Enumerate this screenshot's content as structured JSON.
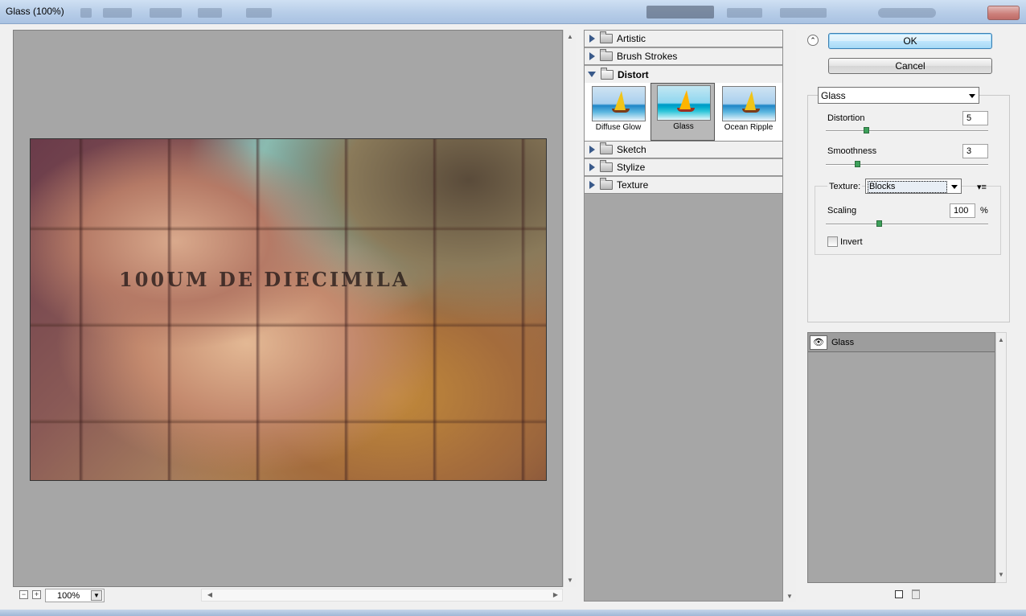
{
  "window": {
    "title": "Glass (100%)"
  },
  "preview": {
    "caption": "100UM DE DIECIMILA",
    "zoom_value": "100%",
    "zoom_out_label": "−",
    "zoom_in_label": "+"
  },
  "filter_gallery": {
    "categories": [
      {
        "label": "Artistic"
      },
      {
        "label": "Brush Strokes"
      },
      {
        "label": "Distort"
      },
      {
        "label": "Sketch"
      },
      {
        "label": "Stylize"
      },
      {
        "label": "Texture"
      }
    ],
    "distort_filters": [
      {
        "label": "Diffuse Glow"
      },
      {
        "label": "Glass"
      },
      {
        "label": "Ocean Ripple"
      }
    ],
    "selected_filter": "Glass"
  },
  "buttons": {
    "ok": "OK",
    "cancel": "Cancel",
    "expand_icon": "⌃"
  },
  "settings": {
    "filter_select": "Glass",
    "distortion": {
      "label": "Distortion",
      "value": "5",
      "level": 0.25
    },
    "smoothness": {
      "label": "Smoothness",
      "value": "3",
      "level": 0.2
    },
    "texture": {
      "label": "Texture:",
      "value": "Blocks",
      "menu_icon": "▾≡"
    },
    "scaling": {
      "label": "Scaling",
      "value": "100",
      "unit": "%",
      "level": 0.33
    },
    "invert": {
      "label": "Invert",
      "checked": false
    }
  },
  "effect_layers": [
    {
      "label": "Glass",
      "eye_icon": "👁"
    }
  ],
  "colors": {
    "accent": "#3c7fb1",
    "slider_thumb": "#3da05a",
    "panel_gray": "#a6a6a6"
  }
}
